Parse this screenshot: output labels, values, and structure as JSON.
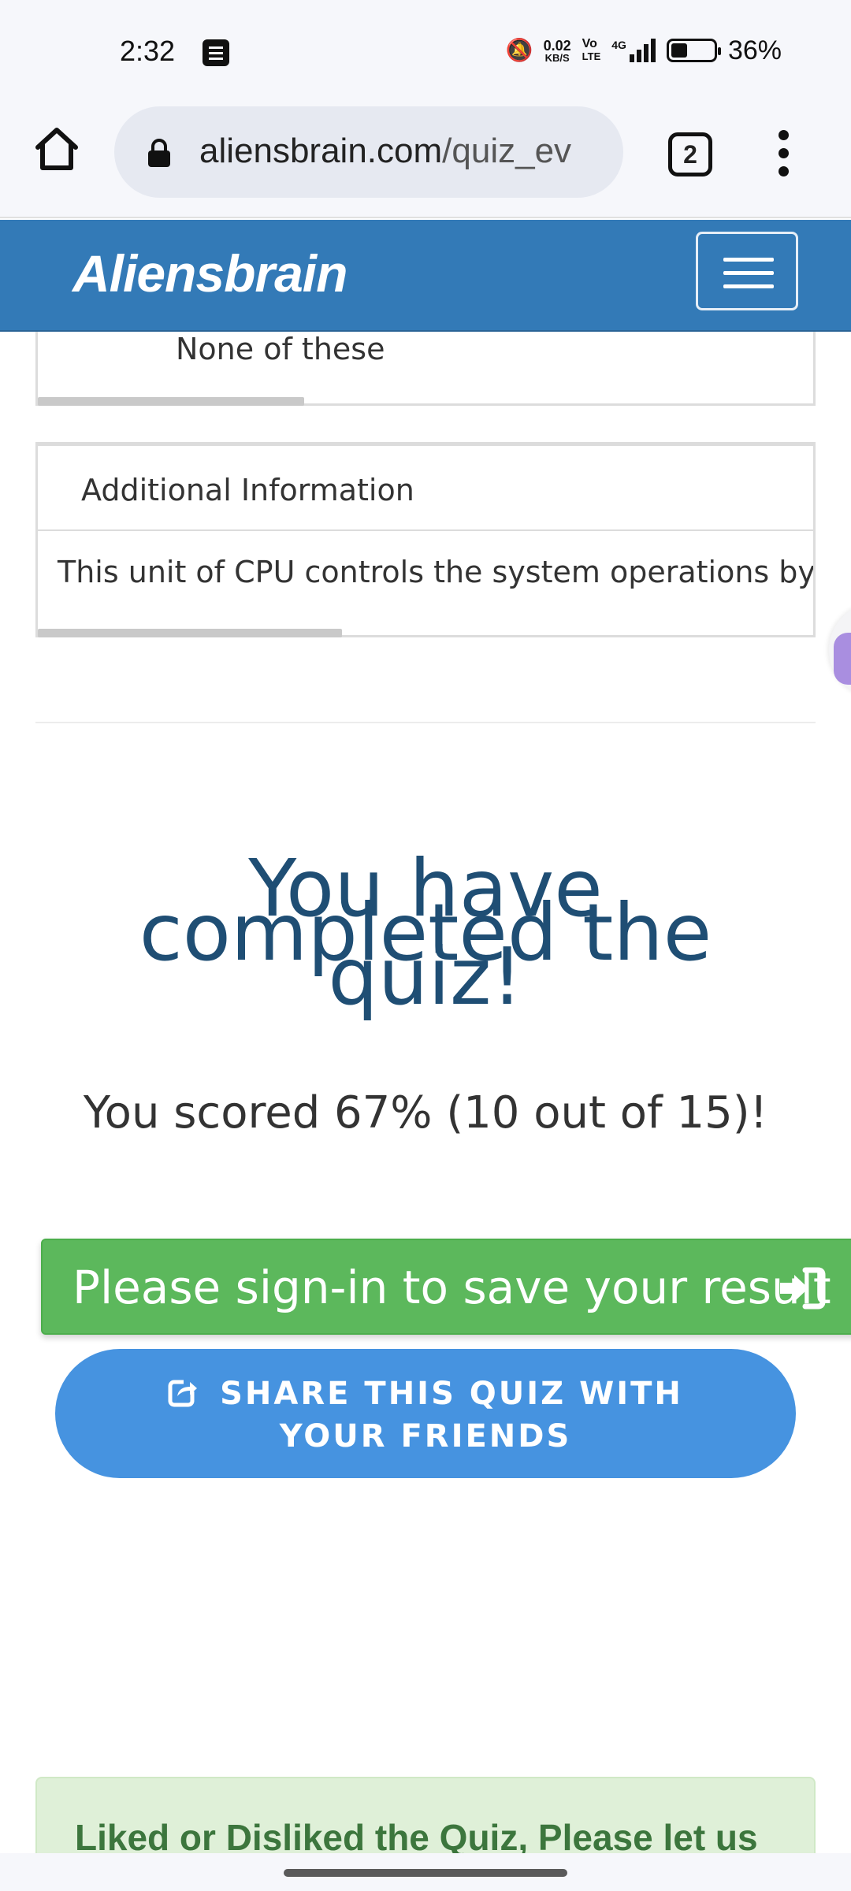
{
  "status_bar": {
    "time": "2:32",
    "net_speed_value": "0.02",
    "net_speed_unit": "KB/S",
    "volte_line1": "Vo",
    "volte_line2": "LTE",
    "network": "4G",
    "battery": "36%"
  },
  "browser": {
    "url_domain": "aliensbrain.com",
    "url_path": "/quiz_ev",
    "tab_count": "2"
  },
  "header": {
    "brand": "Aliensbrain"
  },
  "question": {
    "last_option": "None of these"
  },
  "additional_info": {
    "heading": "Additional Information",
    "text": "This unit of CPU controls the system operations by ro"
  },
  "result": {
    "title": "You have completed the quiz!",
    "score_text": "You scored 67% (10 out of 15)!",
    "signin_label": "Please sign-in to save your result",
    "share_label": "SHARE THIS QUIZ WITH YOUR FRIENDS"
  },
  "feedback": {
    "text": "Liked or Disliked the Quiz, Please let us"
  },
  "colors": {
    "header_blue": "#337ab7",
    "title_navy": "#1f4e74",
    "signin_green": "#5cb85c",
    "share_blue": "#4693e0",
    "feedback_bg": "#dff0d8"
  }
}
